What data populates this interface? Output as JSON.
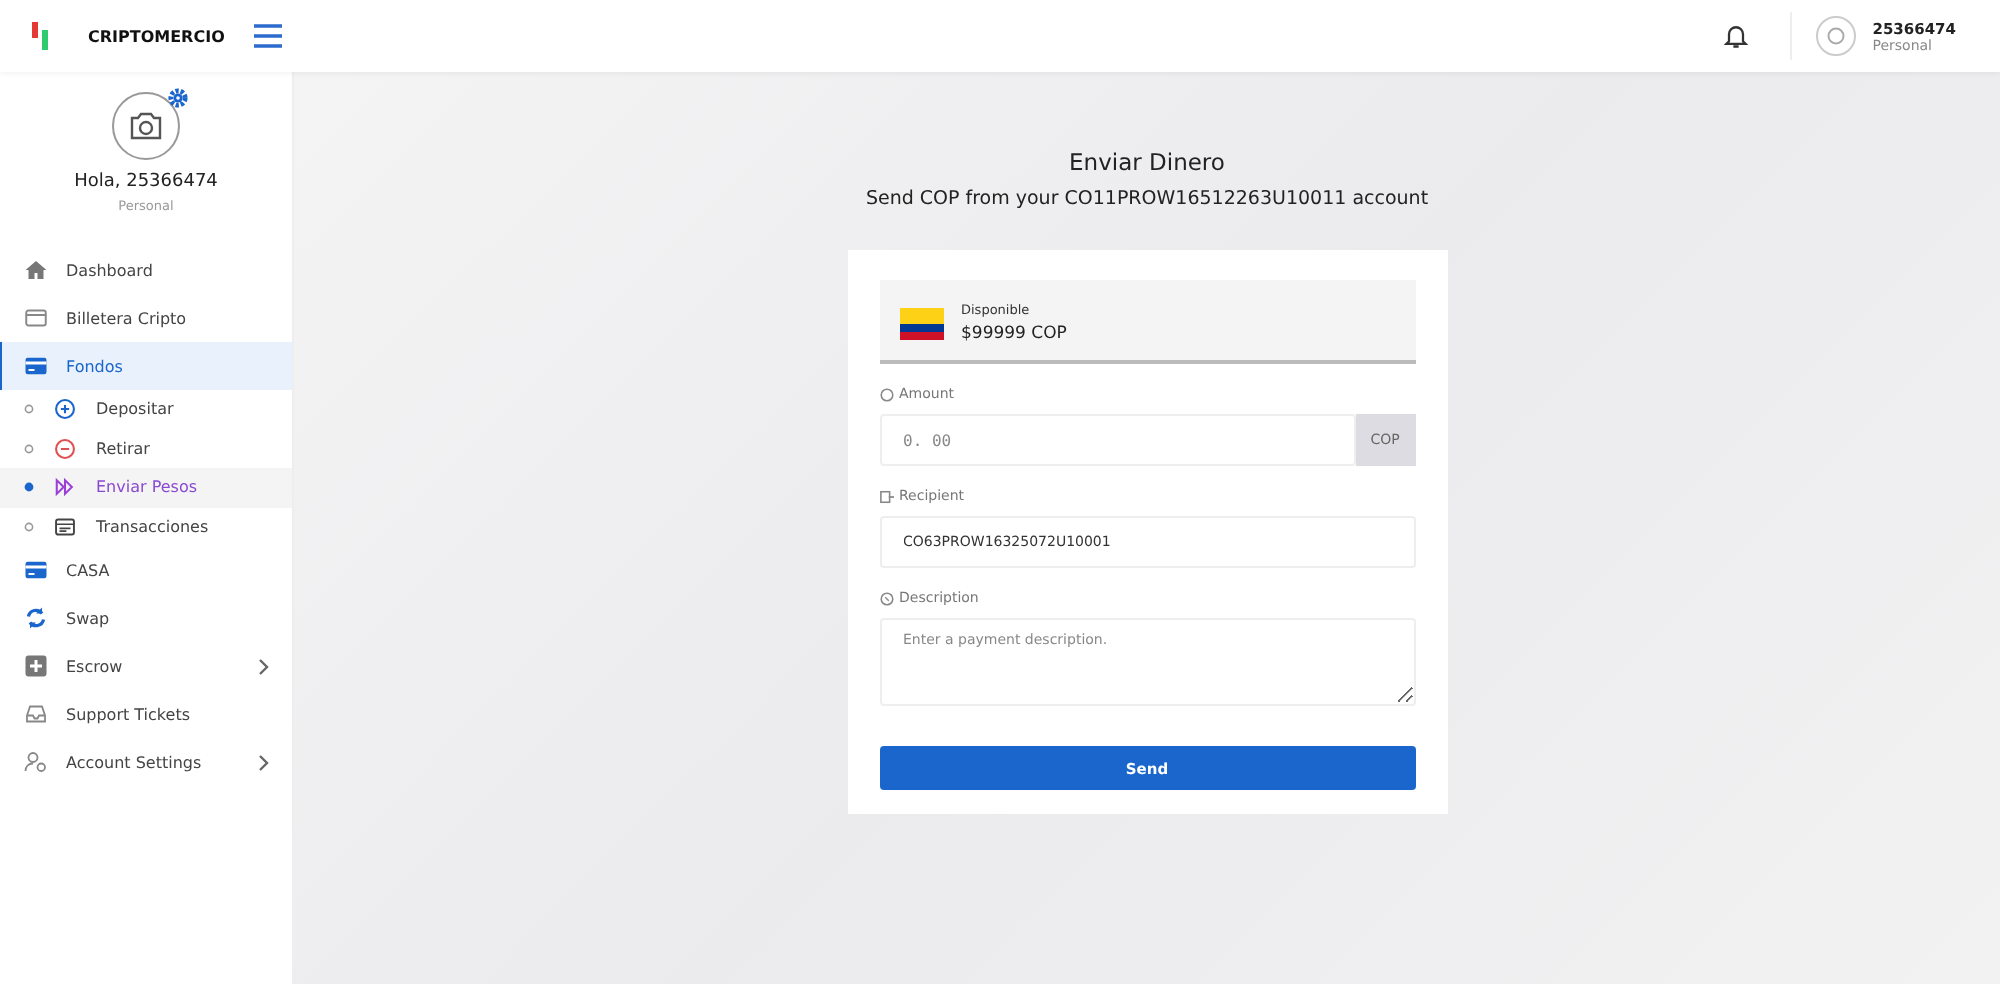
{
  "header": {
    "brand": "CRIPTOMERCIO",
    "user": {
      "name": "25366474",
      "role": "Personal"
    }
  },
  "profile": {
    "greeting": "Hola, 25366474",
    "role": "Personal"
  },
  "sidebar": {
    "items": [
      {
        "label": "Dashboard",
        "selected": false,
        "expandable": false
      },
      {
        "label": "Billetera Cripto",
        "selected": false,
        "expandable": false
      },
      {
        "label": "Fondos",
        "selected": true,
        "expandable": false,
        "children": [
          {
            "label": "Depositar",
            "selected": false
          },
          {
            "label": "Retirar",
            "selected": false
          },
          {
            "label": "Enviar Pesos",
            "selected": true
          },
          {
            "label": "Transacciones",
            "selected": false
          }
        ]
      },
      {
        "label": "CASA",
        "selected": false,
        "expandable": false
      },
      {
        "label": "Swap",
        "selected": false,
        "expandable": false
      },
      {
        "label": "Escrow",
        "selected": false,
        "expandable": true
      },
      {
        "label": "Support Tickets",
        "selected": false,
        "expandable": false
      },
      {
        "label": "Account Settings",
        "selected": false,
        "expandable": true
      }
    ]
  },
  "page": {
    "title": "Enviar Dinero",
    "subtitle": "Send COP from your CO11PROW16512263U10011 account"
  },
  "form": {
    "balance": {
      "label": "Disponible",
      "amount": "$99999 COP"
    },
    "amount": {
      "label": "Amount",
      "placeholder": "0. 00",
      "currency": "COP"
    },
    "recipient": {
      "label": "Recipient",
      "value": "CO63PROW16325072U10001"
    },
    "description": {
      "label": "Description",
      "placeholder": "Enter a payment description."
    },
    "submit": "Send"
  }
}
